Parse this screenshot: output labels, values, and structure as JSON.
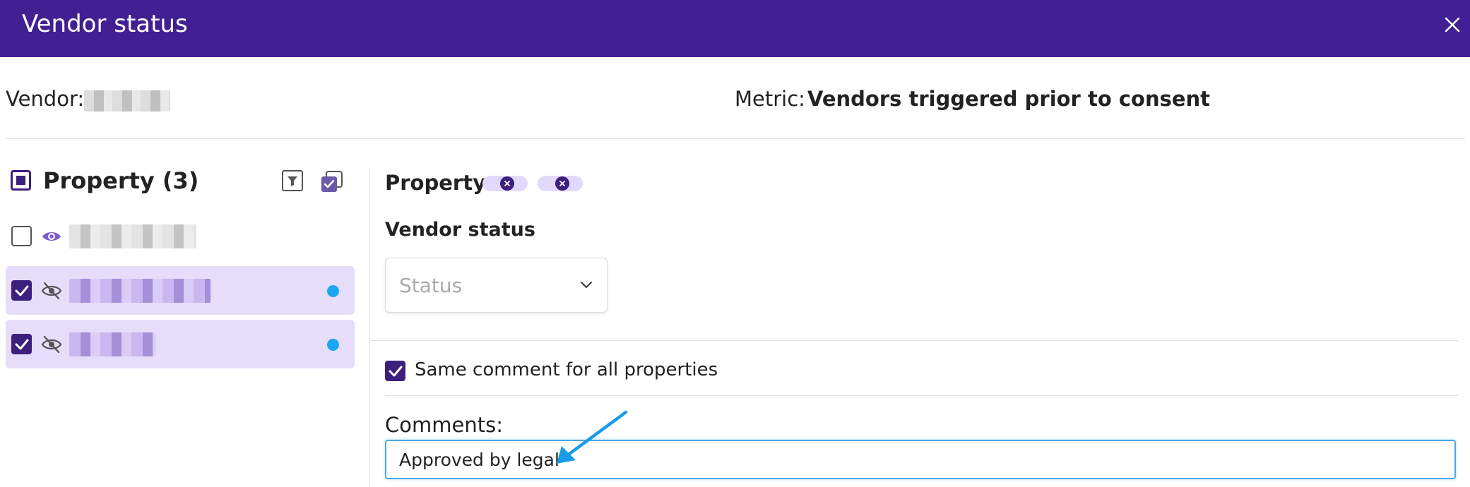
{
  "dialog": {
    "title": "Vendor status"
  },
  "info": {
    "vendor_label": "Vendor:",
    "metric_label": "Metric:",
    "metric_value": "Vendors triggered prior to consent"
  },
  "left_panel": {
    "header_label": "Property (3)",
    "rows": [
      {
        "checked": false,
        "visible": true,
        "has_dot": false
      },
      {
        "checked": true,
        "visible": false,
        "has_dot": true
      },
      {
        "checked": true,
        "visible": false,
        "has_dot": true
      }
    ]
  },
  "right_panel": {
    "property_label": "Property:",
    "vendor_status_label": "Vendor status",
    "status_placeholder": "Status",
    "same_comment_label": "Same comment for all properties",
    "comments_label": "Comments:",
    "comments_value": "Approved by legal"
  },
  "colors": {
    "header_bg": "#431f94",
    "accent": "#3d1f7d",
    "row_selected": "#e6ddfb",
    "dot": "#1aa6f0",
    "annotation_arrow": "#1a9be8"
  }
}
